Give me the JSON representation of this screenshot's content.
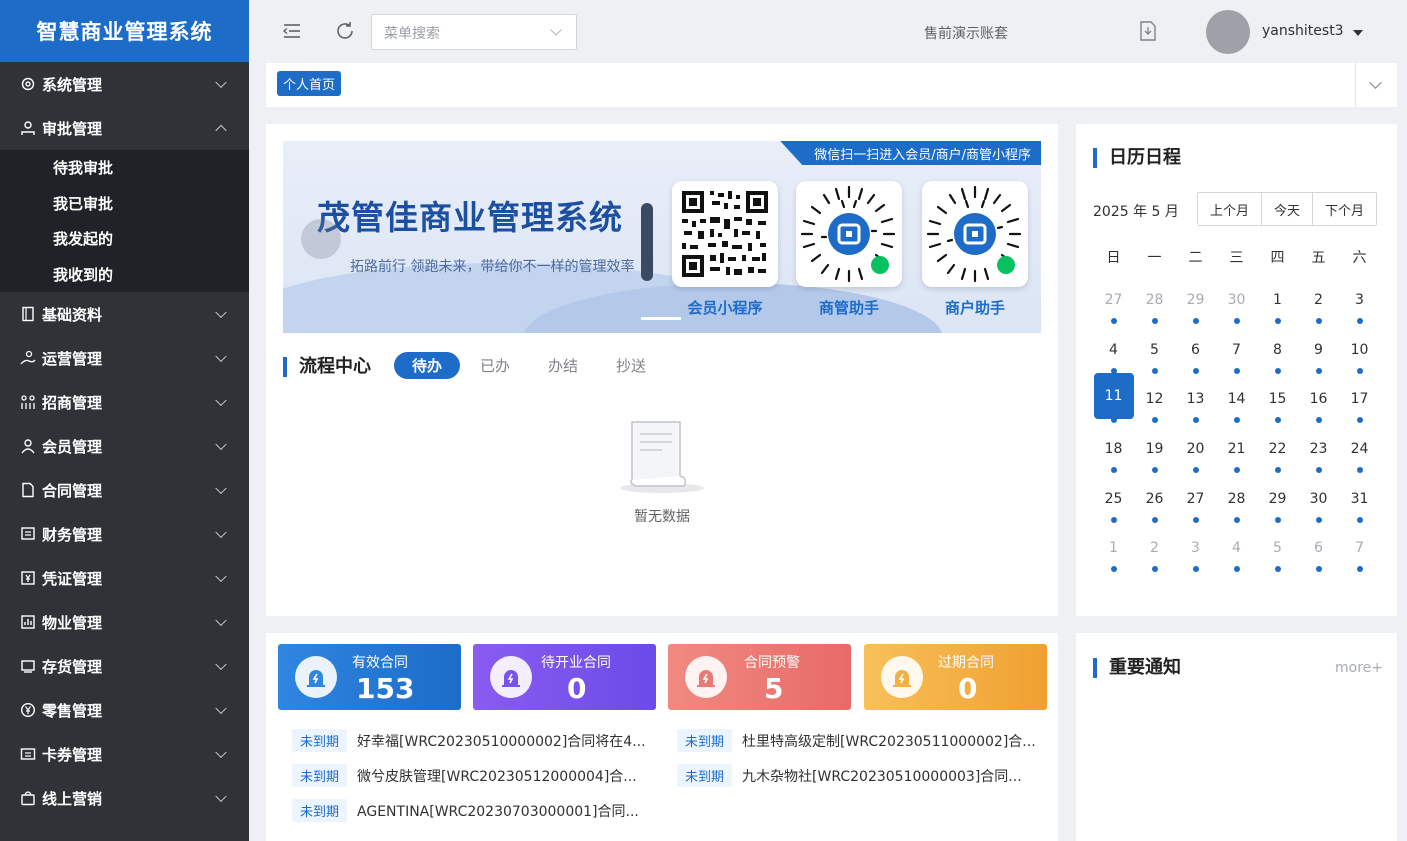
{
  "app": {
    "title": "智慧商业管理系统"
  },
  "sidebar": {
    "items": [
      {
        "label": "系统管理",
        "icon": "gear-icon",
        "expanded": false
      },
      {
        "label": "审批管理",
        "icon": "user-check-icon",
        "expanded": true
      },
      {
        "label": "基础资料",
        "icon": "book-icon",
        "expanded": false
      },
      {
        "label": "运营管理",
        "icon": "operation-icon",
        "expanded": false
      },
      {
        "label": "招商管理",
        "icon": "people-icon",
        "expanded": false
      },
      {
        "label": "会员管理",
        "icon": "member-icon",
        "expanded": false
      },
      {
        "label": "合同管理",
        "icon": "contract-icon",
        "expanded": false
      },
      {
        "label": "财务管理",
        "icon": "finance-icon",
        "expanded": false
      },
      {
        "label": "凭证管理",
        "icon": "voucher-icon",
        "expanded": false
      },
      {
        "label": "物业管理",
        "icon": "property-icon",
        "expanded": false
      },
      {
        "label": "存货管理",
        "icon": "inventory-icon",
        "expanded": false
      },
      {
        "label": "零售管理",
        "icon": "yen-icon",
        "expanded": false
      },
      {
        "label": "卡券管理",
        "icon": "coupon-icon",
        "expanded": false
      },
      {
        "label": "线上营销",
        "icon": "bag-icon",
        "expanded": false
      }
    ],
    "approval_sub": [
      "待我审批",
      "我已审批",
      "我发起的",
      "我收到的"
    ]
  },
  "topbar": {
    "search_placeholder": "菜单搜索",
    "account_set": "售前演示账套",
    "username": "yanshitest3"
  },
  "tabs": {
    "active": "个人首页"
  },
  "banner": {
    "ribbon": "微信扫一扫进入会员/商户/商管小程序",
    "title": "茂管佳商业管理系统",
    "subtitle": "拓路前行 领跑未来，带给你不一样的管理效率",
    "qr_labels": [
      "会员小程序",
      "商管助手",
      "商户助手"
    ]
  },
  "flow": {
    "title": "流程中心",
    "tabs": [
      "待办",
      "已办",
      "办结",
      "抄送"
    ],
    "active_tab": "待办",
    "empty_text": "暂无数据"
  },
  "calendar": {
    "title": "日历日程",
    "month_label": "2025 年 5 月",
    "buttons": [
      "上个月",
      "今天",
      "下个月"
    ],
    "weekdays": [
      "日",
      "一",
      "二",
      "三",
      "四",
      "五",
      "六"
    ],
    "days": [
      {
        "d": "27",
        "o": true
      },
      {
        "d": "28",
        "o": true
      },
      {
        "d": "29",
        "o": true
      },
      {
        "d": "30",
        "o": true
      },
      {
        "d": "1"
      },
      {
        "d": "2"
      },
      {
        "d": "3"
      },
      {
        "d": "4"
      },
      {
        "d": "5"
      },
      {
        "d": "6"
      },
      {
        "d": "7"
      },
      {
        "d": "8"
      },
      {
        "d": "9"
      },
      {
        "d": "10"
      },
      {
        "d": "11",
        "t": true
      },
      {
        "d": "12"
      },
      {
        "d": "13"
      },
      {
        "d": "14"
      },
      {
        "d": "15"
      },
      {
        "d": "16"
      },
      {
        "d": "17"
      },
      {
        "d": "18"
      },
      {
        "d": "19"
      },
      {
        "d": "20"
      },
      {
        "d": "21"
      },
      {
        "d": "22"
      },
      {
        "d": "23"
      },
      {
        "d": "24"
      },
      {
        "d": "25"
      },
      {
        "d": "26"
      },
      {
        "d": "27"
      },
      {
        "d": "28"
      },
      {
        "d": "29"
      },
      {
        "d": "30"
      },
      {
        "d": "31"
      },
      {
        "d": "1",
        "o": true
      },
      {
        "d": "2",
        "o": true
      },
      {
        "d": "3",
        "o": true
      },
      {
        "d": "4",
        "o": true
      },
      {
        "d": "5",
        "o": true
      },
      {
        "d": "6",
        "o": true
      },
      {
        "d": "7",
        "o": true
      }
    ],
    "today": "11"
  },
  "contracts": {
    "stats": [
      {
        "label": "有效合同",
        "value": "153",
        "color_from": "#2f86e0",
        "color_to": "#1c6cc8"
      },
      {
        "label": "待开业合同",
        "value": "0",
        "color_from": "#8a5cf0",
        "color_to": "#6a4be8"
      },
      {
        "label": "合同预警",
        "value": "5",
        "color_from": "#f08a80",
        "color_to": "#e86a68"
      },
      {
        "label": "过期合同",
        "value": "0",
        "color_from": "#f8c05a",
        "color_to": "#f0a030"
      }
    ],
    "items": [
      {
        "tag": "未到期",
        "text": "好幸福[WRC20230510000002]合同将在4..."
      },
      {
        "tag": "未到期",
        "text": "杜里特高级定制[WRC20230511000002]合..."
      },
      {
        "tag": "未到期",
        "text": "微兮皮肤管理[WRC20230512000004]合..."
      },
      {
        "tag": "未到期",
        "text": "九木杂物社[WRC20230510000003]合同..."
      },
      {
        "tag": "未到期",
        "text": "AGENTINA[WRC20230703000001]合同..."
      }
    ]
  },
  "notice": {
    "title": "重要通知",
    "more": "more+"
  },
  "colors": {
    "primary": "#1c6cc8",
    "sidebar": "#2f3338",
    "sidebar_sub": "#1f2226"
  }
}
